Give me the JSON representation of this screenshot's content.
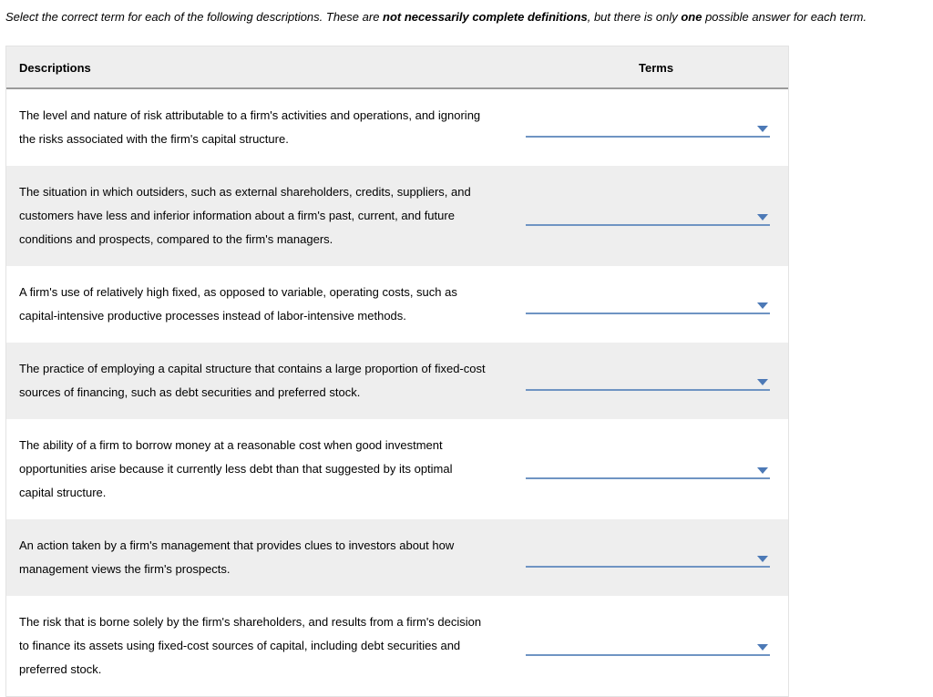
{
  "instructions": {
    "pre": "Select the correct term for each of the following descriptions. These are ",
    "bold1": "not necessarily complete definitions",
    "mid": ", but there is only ",
    "bold2": "one",
    "post": " possible answer for each term."
  },
  "headers": {
    "descriptions": "Descriptions",
    "terms": "Terms"
  },
  "rows": [
    {
      "desc": "The level and nature of risk attributable to a firm's activities and operations, and ignoring the risks associated with the firm's capital structure."
    },
    {
      "desc": "The situation in which outsiders, such as external shareholders, credits, suppliers, and customers have less and inferior information about a firm's past, current, and future conditions and prospects, compared to the firm's managers."
    },
    {
      "desc": "A firm's use of relatively high fixed, as opposed to variable, operating costs, such as capital-intensive productive processes instead of labor-intensive methods."
    },
    {
      "desc": "The practice of employing a capital structure that contains a large proportion of fixed-cost sources of financing, such as debt securities and preferred stock."
    },
    {
      "desc": "The ability of a firm to borrow money at a reasonable cost when good investment opportunities arise because it currently less debt than that suggested by its optimal capital structure."
    },
    {
      "desc": "An action taken by a firm's management that provides clues to investors about how management views the firm's prospects."
    },
    {
      "desc": "The risk that is borne solely by the firm's shareholders, and results from a firm's decision to finance its assets using fixed-cost sources of capital, including debt securities and preferred stock."
    }
  ]
}
